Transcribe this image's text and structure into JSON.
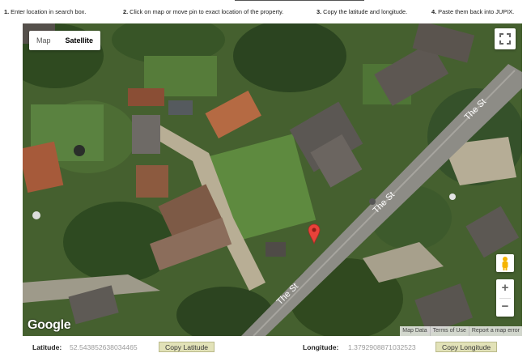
{
  "instructions": [
    {
      "number": "1.",
      "text": "Enter location in search box."
    },
    {
      "number": "2.",
      "text": "Click on map or move pin to exact location of the property."
    },
    {
      "number": "3.",
      "text": "Copy the latitude and longitude."
    },
    {
      "number": "4.",
      "text": "Paste them back into JUPIX."
    }
  ],
  "map": {
    "type_buttons": {
      "map": "Map",
      "satellite": "Satellite",
      "selected": "Satellite"
    },
    "road_labels": [
      "The St",
      "The St",
      "The St"
    ],
    "logo": "Google",
    "attribution": [
      "Map Data",
      "Terms of Use",
      "Report a map error"
    ],
    "zoom": {
      "in": "+",
      "out": "−"
    },
    "icons": [
      "fullscreen-icon",
      "pegman-icon",
      "map-pin-icon"
    ],
    "pin_color": "#e8423a"
  },
  "coordinates": {
    "latitude_label": "Latitude:",
    "latitude_value": "52.543852638034465",
    "copy_latitude": "Copy Latitude",
    "longitude_label": "Longitude:",
    "longitude_value": "1.3792908871032523",
    "copy_longitude": "Copy Longitude"
  }
}
